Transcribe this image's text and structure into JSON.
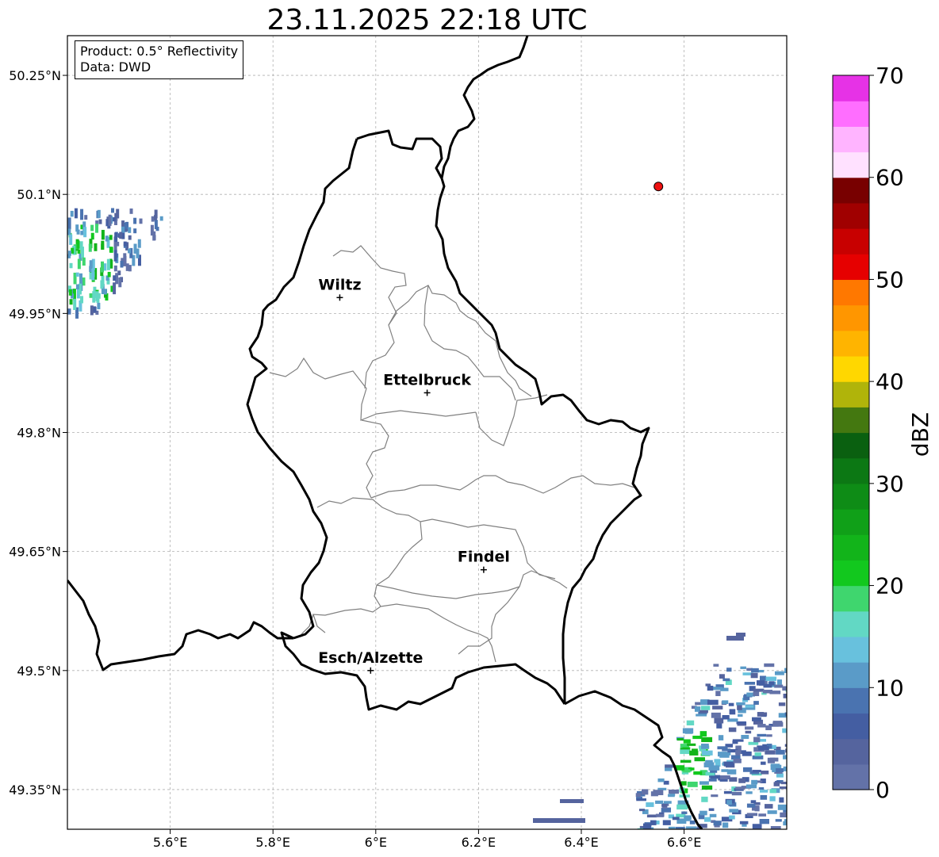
{
  "title": "23.11.2025 22:18 UTC",
  "info": {
    "product": "Product: 0.5° Reflectivity",
    "source": "Data: DWD"
  },
  "map": {
    "lon_range": [
      5.4,
      6.8
    ],
    "lat_range": [
      49.3,
      50.3
    ],
    "x_ticks": [
      "5.6°E",
      "5.8°E",
      "6°E",
      "6.2°E",
      "6.4°E",
      "6.6°E"
    ],
    "y_ticks": [
      "50.25°N",
      "50.1°N",
      "49.95°N",
      "49.8°N",
      "49.65°N",
      "49.5°N",
      "49.35°N"
    ],
    "grid": true,
    "cities": [
      {
        "name": "Wiltz",
        "lon": 5.93,
        "lat": 49.97
      },
      {
        "name": "Ettelbruck",
        "lon": 6.1,
        "lat": 49.85
      },
      {
        "name": "Findel",
        "lon": 6.21,
        "lat": 49.627
      },
      {
        "name": "Esch/Alzette",
        "lon": 5.99,
        "lat": 49.5
      }
    ],
    "radar_site": {
      "lon": 6.55,
      "lat": 50.11,
      "color": "#ee1111"
    }
  },
  "colorbar": {
    "label": "dBZ",
    "ticks": [
      "0",
      "10",
      "20",
      "30",
      "40",
      "50",
      "60",
      "70"
    ],
    "colors": [
      "#6372a8",
      "#55649e",
      "#445ea2",
      "#4a73b0",
      "#5a9bc8",
      "#68c1dd",
      "#62d8c4",
      "#3fd66e",
      "#12c81e",
      "#12b41a",
      "#10a018",
      "#0e8c16",
      "#0c7814",
      "#0a6010",
      "#447810",
      "#b0b40a",
      "#ffd700",
      "#ffb400",
      "#ff9600",
      "#ff7800",
      "#e60000",
      "#c80000",
      "#a00000",
      "#780000",
      "#ffe1ff",
      "#ffb4ff",
      "#ff6eff",
      "#e632e6"
    ]
  }
}
